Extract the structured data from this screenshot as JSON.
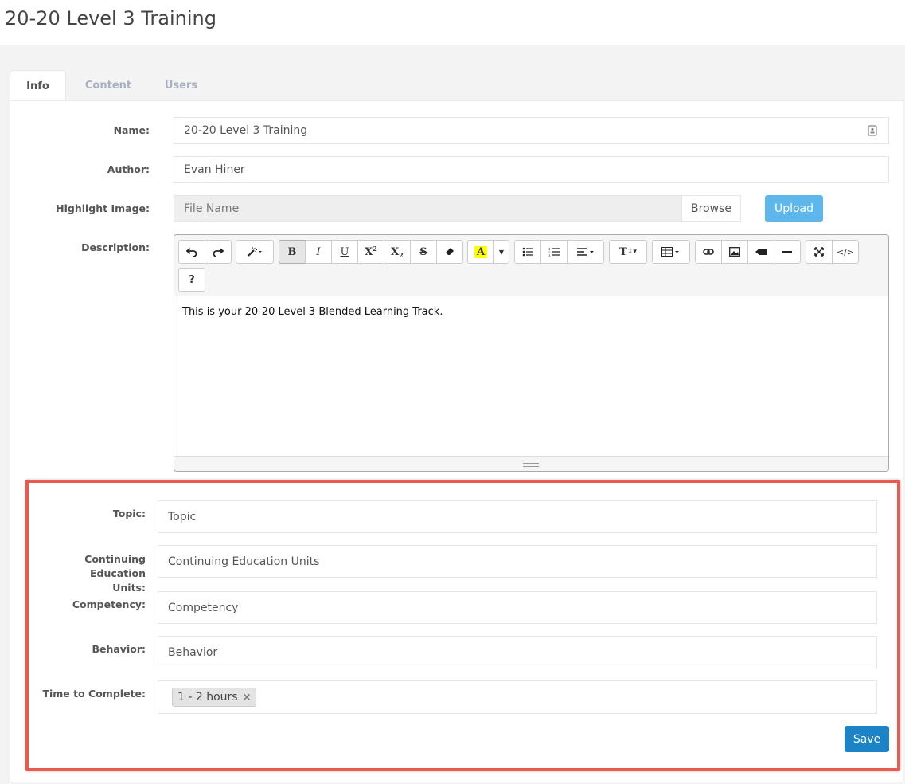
{
  "page": {
    "title": "20-20 Level 3 Training"
  },
  "tabs": [
    {
      "label": "Info",
      "active": true
    },
    {
      "label": "Content",
      "active": false
    },
    {
      "label": "Users",
      "active": false
    }
  ],
  "form": {
    "name": {
      "label": "Name:",
      "value": "20-20 Level 3 Training"
    },
    "author": {
      "label": "Author:",
      "value": "Evan Hiner"
    },
    "highlight_image": {
      "label": "Highlight Image:",
      "placeholder": "File Name",
      "browse_label": "Browse",
      "upload_label": "Upload"
    },
    "description": {
      "label": "Description:",
      "content": "This is your 20-20 Level 3 Blended Learning Track."
    },
    "topic": {
      "label": "Topic:",
      "value": "Topic"
    },
    "ceu": {
      "label_line1": "Continuing Education",
      "label_line2": "Units:",
      "value": "Continuing Education Units"
    },
    "competency": {
      "label": "Competency:",
      "value": "Competency"
    },
    "behavior": {
      "label": "Behavior:",
      "value": "Behavior"
    },
    "time_to_complete": {
      "label": "Time to Complete:",
      "tag": "1 - 2 hours",
      "remove_glyph": "×"
    },
    "save_label": "Save"
  },
  "editor_toolbar": {
    "bold": "B",
    "italic": "I",
    "underline": "U",
    "superscript": "X",
    "subscript": "X",
    "strikethrough": "S",
    "highlight": "A",
    "font_size": "T",
    "help": "?",
    "code": "</>"
  },
  "colors": {
    "highlight_box": "#ea5a4e",
    "upload": "#5db7ea",
    "save": "#1c84c6",
    "text_highlight": "#ffff00"
  }
}
